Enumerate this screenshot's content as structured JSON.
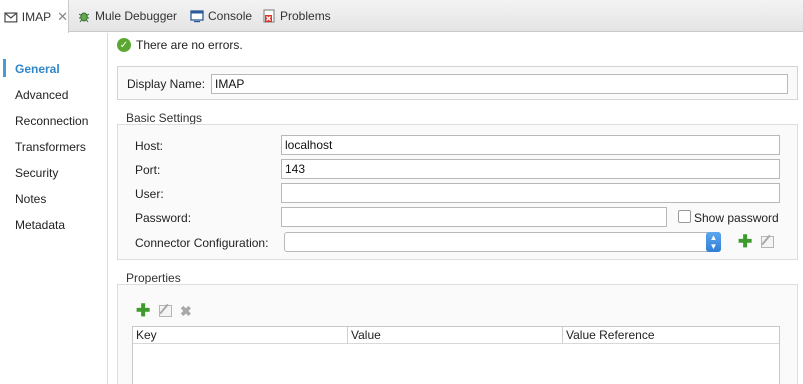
{
  "tabs": [
    {
      "label": "IMAP",
      "icon": "mail-icon",
      "active": true,
      "closable": true
    },
    {
      "label": "Mule Debugger",
      "icon": "bug-icon"
    },
    {
      "label": "Console",
      "icon": "console-icon"
    },
    {
      "label": "Problems",
      "icon": "problems-icon"
    }
  ],
  "nav": {
    "items": [
      "General",
      "Advanced",
      "Reconnection",
      "Transformers",
      "Security",
      "Notes",
      "Metadata"
    ],
    "active_index": 0
  },
  "status": {
    "message": "There are no errors.",
    "icon": "check-circle-icon",
    "color": "#5aa832"
  },
  "display": {
    "label": "Display Name:",
    "value": "IMAP"
  },
  "basic": {
    "title": "Basic Settings",
    "host_label": "Host:",
    "host_value": "localhost",
    "port_label": "Port:",
    "port_value": "143",
    "user_label": "User:",
    "user_value": "",
    "password_label": "Password:",
    "password_value": "",
    "show_password_label": "Show password",
    "connector_label": "Connector Configuration:",
    "connector_value": ""
  },
  "properties": {
    "title": "Properties",
    "columns": [
      "Key",
      "Value",
      "Value Reference"
    ],
    "rows": []
  },
  "colors": {
    "accent": "#2f86c8",
    "add": "#3d9a2c",
    "select_button": "#2f7fd6"
  }
}
